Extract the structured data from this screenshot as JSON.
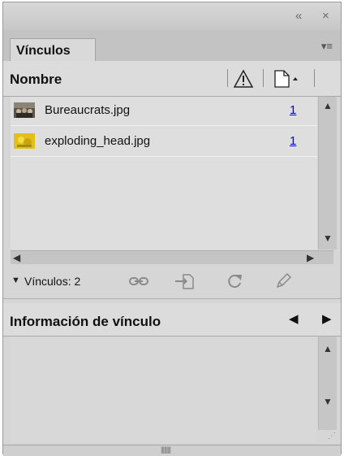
{
  "window": {
    "collapse_glyph": "«",
    "close_glyph": "×"
  },
  "tabs": [
    {
      "label": "Vínculos",
      "active": true
    }
  ],
  "panel_menu_glyph": "▾≡",
  "columns": {
    "name_label": "Nombre",
    "status_icon": "warning-icon",
    "page_icon": "page-icon"
  },
  "links": [
    {
      "name": "Bureaucrats.jpg",
      "page": "1",
      "thumb": "photo-thumbnail"
    },
    {
      "name": "exploding_head.jpg",
      "page": "1",
      "thumb": "yellow-image-thumbnail"
    }
  ],
  "toolbar": {
    "count_label": "Vínculos: 2",
    "icons": [
      "relink-icon",
      "go-to-link-icon",
      "update-link-icon",
      "edit-original-icon"
    ]
  },
  "info": {
    "title": "Información de vínculo"
  },
  "colors": {
    "panel_bg": "#d6d6d6",
    "list_bg": "#dedede",
    "link_blue": "#0000ee"
  }
}
